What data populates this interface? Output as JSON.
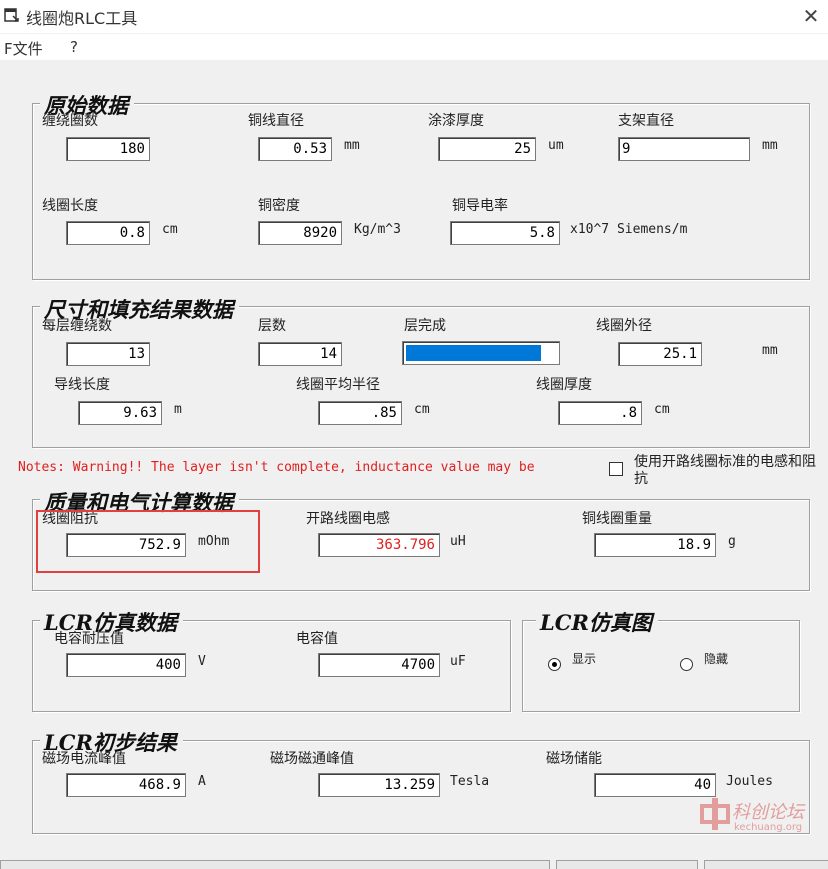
{
  "window": {
    "title": "线圈炮RLC工具"
  },
  "menu": {
    "file": "F文件",
    "help": "?"
  },
  "raw": {
    "title": "原始数据",
    "turns_label": "缠绕圈数",
    "turns_value": "180",
    "wire_dia_label": "铜线直径",
    "wire_dia_value": "0.53",
    "wire_dia_unit": "mm",
    "paint_label": "涂漆厚度",
    "paint_value": "25",
    "paint_unit": "um",
    "bracket_label": "支架直径",
    "bracket_value": "9",
    "bracket_unit": "mm",
    "coil_len_label": "线圈长度",
    "coil_len_value": "0.8",
    "coil_len_unit": "cm",
    "density_label": "铜密度",
    "density_value": "8920",
    "density_unit": "Kg/m^3",
    "conductivity_label": "铜导电率",
    "conductivity_value": "5.8",
    "conductivity_unit": "x10^7 Siemens/m"
  },
  "size": {
    "title": "尺寸和填充结果数据",
    "per_layer_label": "每层缠绕数",
    "per_layer_value": "13",
    "layers_label": "层数",
    "layers_value": "14",
    "layer_complete_label": "层完成",
    "layer_complete_fraction": 0.9,
    "outer_dia_label": "线圈外径",
    "outer_dia_value": "25.1",
    "outer_dia_unit": "mm",
    "wire_len_label": "导线长度",
    "wire_len_value": "9.63",
    "wire_len_unit": "m",
    "avg_radius_label": "线圈平均半径",
    "avg_radius_value": ".85",
    "avg_radius_unit": "cm",
    "thickness_label": "线圈厚度",
    "thickness_value": ".8",
    "thickness_unit": "cm"
  },
  "notes": "Notes: Warning!! The layer isn't complete, inductance value may be",
  "open_std_checkbox_label": "使用开路线圈标准的电感和阻抗",
  "mass": {
    "title": "质量和电气计算数据",
    "resistance_label": "线圈阻抗",
    "resistance_value": "752.9",
    "resistance_unit": "mOhm",
    "inductance_label": "开路线圈电感",
    "inductance_value": "363.796",
    "inductance_unit": "uH",
    "weight_label": "铜线圈重量",
    "weight_value": "18.9",
    "weight_unit": "g"
  },
  "lcr_sim": {
    "title": "LCR仿真数据",
    "cap_voltage_label": "电容耐压值",
    "cap_voltage_value": "400",
    "cap_voltage_unit": "V",
    "capacitance_label": "电容值",
    "capacitance_value": "4700",
    "capacitance_unit": "uF"
  },
  "lcr_graph": {
    "title": "LCR仿真图",
    "show_label": "显示",
    "hide_label": "隐藏",
    "selected": "show"
  },
  "lcr_result": {
    "title": "LCR初步结果",
    "peak_current_label": "磁场电流峰值",
    "peak_current_value": "468.9",
    "peak_current_unit": "A",
    "peak_flux_label": "磁场磁通峰值",
    "peak_flux_value": "13.259",
    "peak_flux_unit": "Tesla",
    "energy_label": "磁场储能",
    "energy_value": "40",
    "energy_unit": "Joules"
  },
  "watermark": {
    "text": "科创论坛",
    "url": "kechuang.org"
  },
  "colors": {
    "progress": "#0078d7",
    "warning": "#e02020",
    "highlight": "#e04040"
  }
}
